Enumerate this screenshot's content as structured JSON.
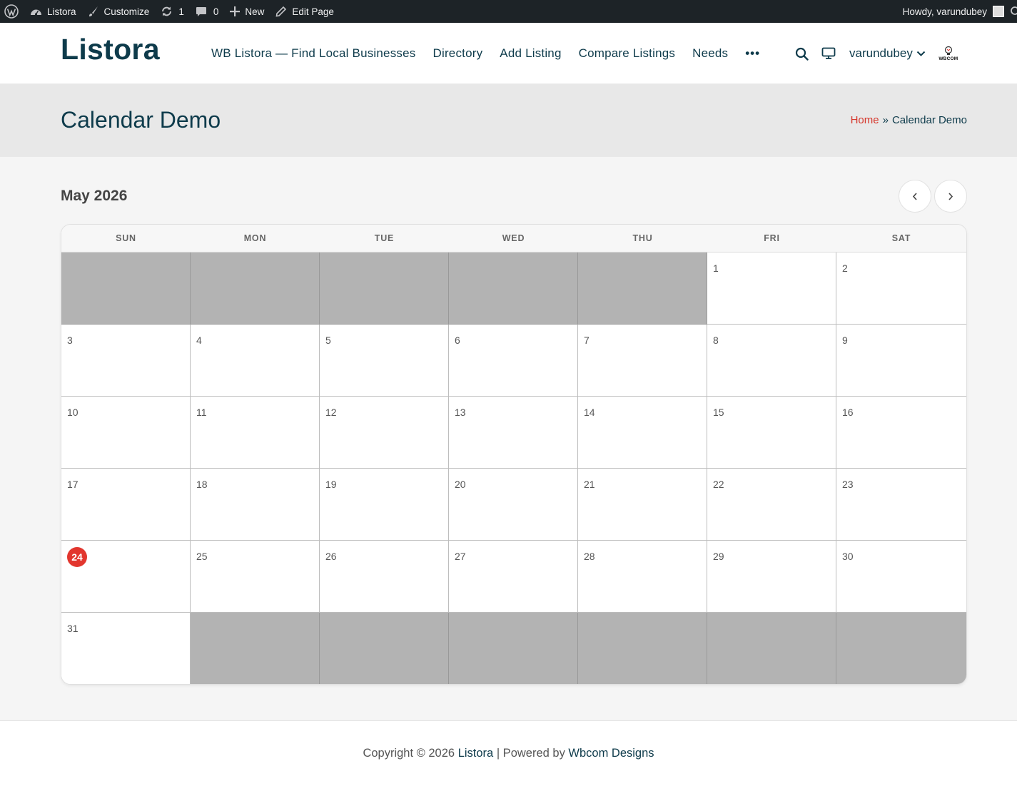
{
  "admin_bar": {
    "site_name": "Listora",
    "customize": "Customize",
    "updates_count": "1",
    "comments_count": "0",
    "new_label": "New",
    "edit_page": "Edit Page",
    "howdy": "Howdy, varundubey"
  },
  "header": {
    "logo": "Listora",
    "nav": [
      "WB Listora — Find Local Businesses",
      "Directory",
      "Add Listing",
      "Compare Listings",
      "Needs"
    ],
    "more": "•••",
    "user": "varundubey",
    "brand_mini": "WBCOM"
  },
  "page": {
    "title": "Calendar Demo",
    "breadcrumb_home": "Home",
    "breadcrumb_sep": "»",
    "breadcrumb_current": "Calendar Demo"
  },
  "calendar": {
    "month_label": "May 2026",
    "weekdays": [
      "SUN",
      "MON",
      "TUE",
      "WED",
      "THU",
      "FRI",
      "SAT"
    ],
    "weeks": [
      [
        "",
        "",
        "",
        "",
        "",
        "1",
        "2"
      ],
      [
        "3",
        "4",
        "5",
        "6",
        "7",
        "8",
        "9"
      ],
      [
        "10",
        "11",
        "12",
        "13",
        "14",
        "15",
        "16"
      ],
      [
        "17",
        "18",
        "19",
        "20",
        "21",
        "22",
        "23"
      ],
      [
        "24",
        "25",
        "26",
        "27",
        "28",
        "29",
        "30"
      ],
      [
        "31",
        "",
        "",
        "",
        "",
        "",
        ""
      ]
    ],
    "today": "24",
    "colors": {
      "today": "#e2362e",
      "outside_day": "#b3b3b3"
    }
  },
  "footer": {
    "prefix": "Copyright © 2026",
    "site_link": "Listora",
    "powered": "| Powered by",
    "powered_link": "Wbcom Designs"
  },
  "colors": {
    "admin_bar": "#1d2327",
    "brand": "#0e3b4b",
    "accent": "#d6382d"
  }
}
